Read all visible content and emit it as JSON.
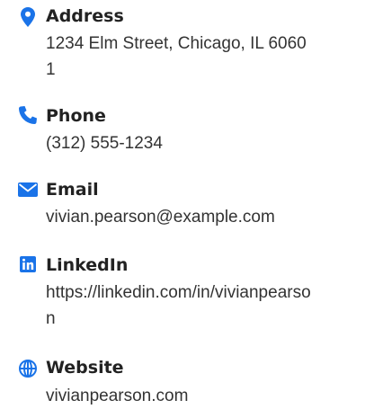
{
  "contact": {
    "accent_color": "#1a73e8",
    "items": [
      {
        "icon": "map-marker-icon",
        "label": "Address",
        "value": "1234 Elm Street, Chicago, IL 60601"
      },
      {
        "icon": "phone-icon",
        "label": "Phone",
        "value": "(312) 555-1234"
      },
      {
        "icon": "envelope-icon",
        "label": "Email",
        "value": "vivian.pearson@example.com"
      },
      {
        "icon": "linkedin-icon",
        "label": "LinkedIn",
        "value": "https://linkedin.com/in/vivianpearson"
      },
      {
        "icon": "globe-icon",
        "label": "Website",
        "value": "vivianpearson.com"
      }
    ]
  }
}
